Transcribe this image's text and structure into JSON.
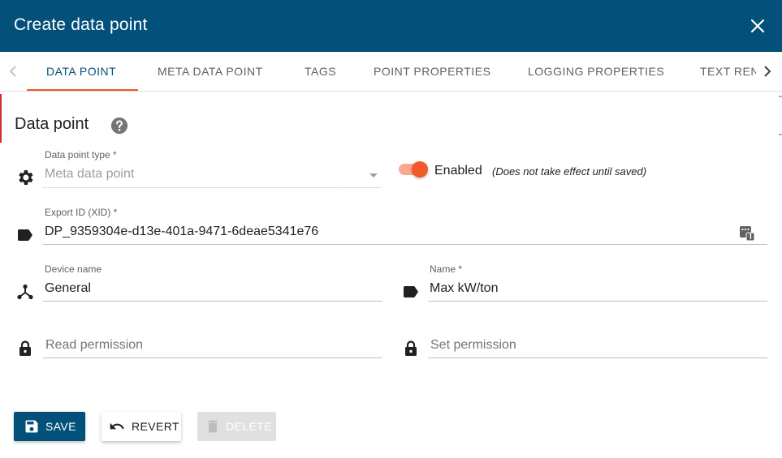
{
  "dialog": {
    "title": "Create data point"
  },
  "tabs": [
    {
      "label": "DATA POINT",
      "active": true
    },
    {
      "label": "META DATA POINT",
      "active": false
    },
    {
      "label": "TAGS",
      "active": false
    },
    {
      "label": "POINT PROPERTIES",
      "active": false
    },
    {
      "label": "LOGGING PROPERTIES",
      "active": false
    },
    {
      "label": "TEXT REN",
      "active": false
    }
  ],
  "section": {
    "title": "Data point"
  },
  "fields": {
    "data_point_type": {
      "label": "Data point type *",
      "value": "Meta data point"
    },
    "enabled": {
      "label": "Enabled",
      "note": "(Does not take effect until saved)",
      "checked": true
    },
    "export_id": {
      "label": "Export ID (XID) *",
      "value": "DP_9359304e-d13e-401a-9471-6deae5341e76"
    },
    "device_name": {
      "label": "Device name",
      "value": "General"
    },
    "name": {
      "label": "Name *",
      "value": "Max kW/ton"
    },
    "read_permission": {
      "placeholder": "Read permission"
    },
    "set_permission": {
      "placeholder": "Set permission"
    }
  },
  "buttons": {
    "save": "SAVE",
    "revert": "REVERT",
    "delete": "DELETE"
  },
  "colors": {
    "header_bg": "#03507a",
    "accent": "#f15a2b",
    "disabled_bg": "#e0e0e0"
  },
  "icons": {
    "close": "close-icon",
    "help": "help-circle-icon",
    "type": "gear-icon",
    "xid": "label-icon",
    "generate": "dice-icon",
    "device": "device-hub-icon",
    "name": "label-icon",
    "permission": "lock-icon",
    "save": "floppy-disk-icon",
    "revert": "undo-icon",
    "delete": "trash-icon"
  }
}
